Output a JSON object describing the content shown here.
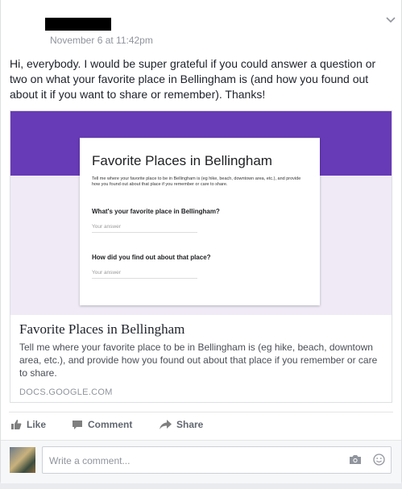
{
  "post": {
    "date": "November 6 at 11:42pm",
    "text": "Hi, everybody. I would be super grateful if you could answer a question or two on what your favorite place in Bellingham is (and how you found out about it if you want to share or remember). Thanks!"
  },
  "form_preview": {
    "title": "Favorite Places in Bellingham",
    "description": "Tell me where your favorite place to be in Bellingham is (eg hike, beach, downtown area, etc.), and provide how you found out about that place if you remember or care to share.",
    "question1": "What's your favorite place in Bellingham?",
    "answer_placeholder1": "Your answer",
    "question2": "How did you find out about that place?",
    "answer_placeholder2": "Your answer"
  },
  "link": {
    "title": "Favorite Places in Bellingham",
    "description": "Tell me where your favorite place to be in Bellingham is (eg hike, beach, downtown area, etc.), and provide how you found out about that place if you remember or care to share.",
    "domain": "DOCS.GOOGLE.COM"
  },
  "actions": {
    "like": "Like",
    "comment": "Comment",
    "share": "Share"
  },
  "comment_input": {
    "placeholder": "Write a comment..."
  },
  "icons": {
    "options": "chevron-down-icon",
    "like": "thumbs-up-icon",
    "comment": "speech-bubble-icon",
    "share": "share-arrow-icon",
    "camera": "camera-icon",
    "emoji": "smiley-icon"
  },
  "colors": {
    "form_header": "#673ab7",
    "form_background": "#efeaf6"
  }
}
